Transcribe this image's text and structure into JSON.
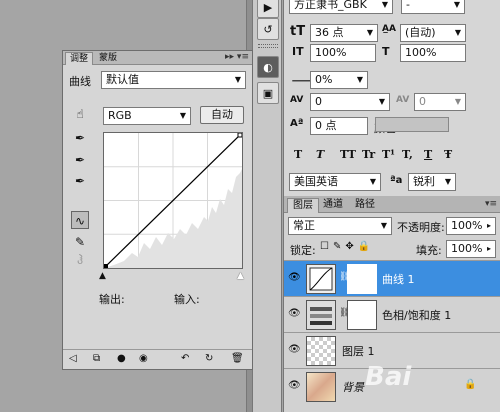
{
  "adjustments": {
    "tabs": [
      "调整",
      "蒙版"
    ],
    "curves_label": "曲线",
    "preset_value": "默认值",
    "channel_value": "RGB",
    "auto_label": "自动",
    "output_label": "输出:",
    "input_label": "输入:"
  },
  "character": {
    "font_name": "方正隶书_GBK",
    "font_style": "-",
    "size": "36 点",
    "leading": "(自动)",
    "vscale": "100%",
    "hscale": "100%",
    "tracking_pct": "0%",
    "kerning": "0",
    "tracking": "0",
    "baseline": "0 点",
    "color_label": "颜色:",
    "style_buttons": [
      "T",
      "T",
      "TT",
      "Tr",
      "T¹",
      "T,",
      "T",
      "Ŧ"
    ],
    "language": "美国英语",
    "aa_label": "ªa",
    "aa_value": "锐利"
  },
  "layers": {
    "tabs": [
      "图层",
      "通道",
      "路径"
    ],
    "blend_mode": "常正",
    "opacity_label": "不透明度:",
    "opacity": "100%",
    "lock_label": "锁定:",
    "fill_label": "填充:",
    "fill": "100%",
    "items": [
      {
        "name": "曲线 1",
        "selected": true
      },
      {
        "name": "色相/饱和度 1",
        "selected": false
      },
      {
        "name": "图层 1",
        "selected": false
      },
      {
        "name": "背景",
        "selected": false
      }
    ]
  },
  "watermark": "Bai"
}
